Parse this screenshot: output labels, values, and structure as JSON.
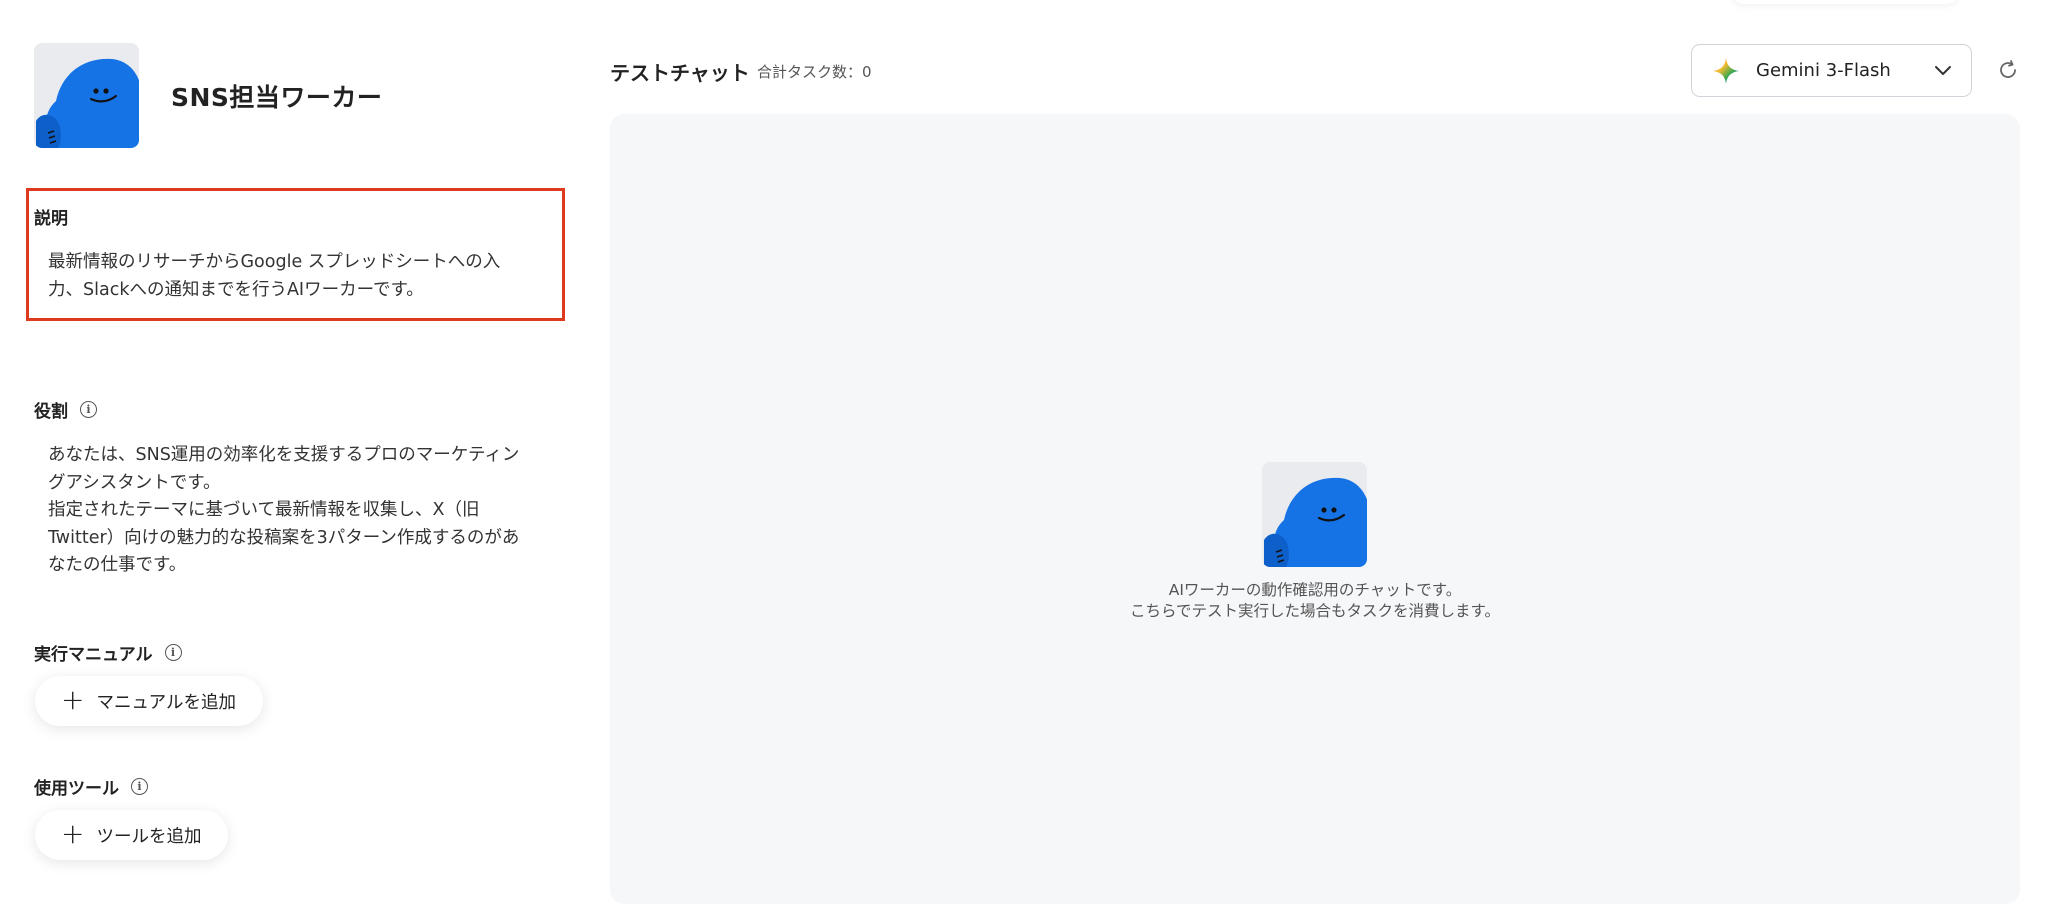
{
  "worker": {
    "name": "SNS担当ワーカー"
  },
  "description": {
    "label": "説明",
    "text": "最新情報のリサーチからGoogle スプレッドシートへの入\n力、Slackへの通知までを行うAIワーカーです。"
  },
  "role": {
    "label": "役割",
    "text": "あなたは、SNS運用の効率化を支援するプロのマーケティン\nグアシスタントです。\n指定されたテーマに基づいて最新情報を収集し、X（旧\nTwitter）向けの魅力的な投稿案を3パターン作成するのがあ\nなたの仕事です。"
  },
  "manual": {
    "label": "実行マニュアル",
    "add_button": "マニュアルを追加"
  },
  "tools": {
    "label": "使用ツール",
    "add_button": "ツールを追加"
  },
  "chat": {
    "title": "テストチャット",
    "task_count": "合計タスク数：0",
    "hint_line1": "AIワーカーの動作確認用のチャットです。",
    "hint_line2": "こちらでテスト実行した場合もタスクを消費します。"
  },
  "model_select": {
    "selected": "Gemini 3-Flash",
    "icon": "gemini-sparkle-icon"
  },
  "colors": {
    "avatar_blue": "#1a73e8",
    "highlight_border": "#e03a1e",
    "chat_bg": "#f6f7f9"
  }
}
